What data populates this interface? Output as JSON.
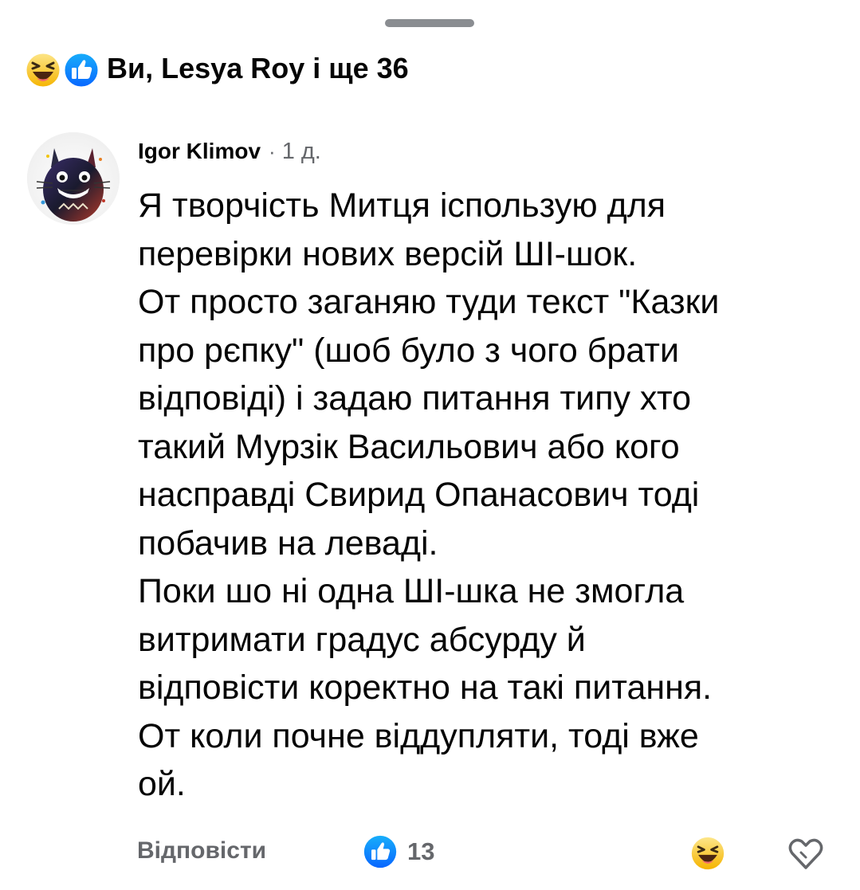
{
  "reactions": {
    "summary_text": "Ви, Lesya Roy і ще 36",
    "icons": [
      "haha-icon",
      "like-icon"
    ]
  },
  "comment": {
    "author": "Igor Klimov",
    "separator": "·",
    "time": "1 д.",
    "text": "Я творчість Митця іспользую для\nперевірки нових версій ШІ-шок.\nОт просто заганяю туди текст \"Казки\nпро рєпку\" (шоб було з чого брати\nвідповіді) і задаю питання типу хто\nтакий Мурзік Васильович або кого\nнасправді Свирид Опанасович тоді\nпобачив на леваді.\nПоки шо ні одна ШІ-шка не змогла\nвитримати градус абсурду й\nвідповісти коректно на такі питання.\nОт коли почне віддупляти, тоді вже\nой."
  },
  "actions": {
    "reply_label": "Відповісти",
    "like_count": "13",
    "react_icon": "haha-icon",
    "extra_icon": "heart-outline-icon"
  },
  "colors": {
    "like_blue": "#1b74e4",
    "haha_yellow": "#fcd34d",
    "secondary_text": "#65676b",
    "handle": "#8a8d91"
  }
}
